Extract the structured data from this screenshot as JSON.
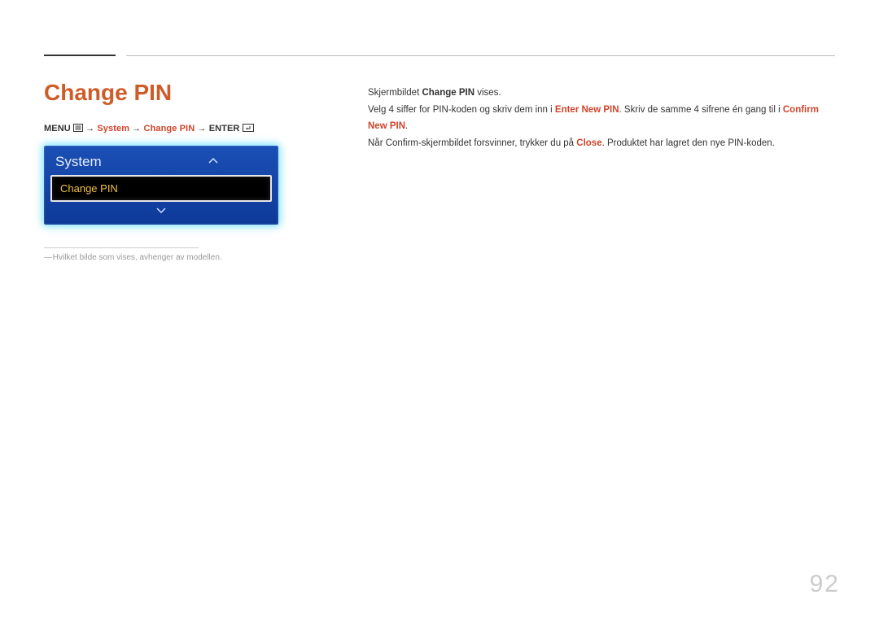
{
  "page": {
    "title": "Change PIN",
    "number": "92"
  },
  "breadcrumb": {
    "menu": "MENU",
    "arrow": " → ",
    "part1": "System",
    "part2": "Change PIN",
    "enter": "ENTER"
  },
  "tv_menu": {
    "header": "System",
    "selected": "Change PIN"
  },
  "footnote": "Hvilket bilde som vises, avhenger av modellen.",
  "body": {
    "line1_pre": "Skjermbildet ",
    "line1_bold": "Change PIN",
    "line1_post": " vises.",
    "line2_pre": "Velg 4 siffer for PIN-koden og skriv dem inn i ",
    "line2_red1": "Enter New PIN",
    "line2_mid": ". Skriv de samme 4 sifrene én gang til i ",
    "line2_red2": "Confirm New PIN",
    "line2_post": ".",
    "line3_pre": "Når Confirm-skjermbildet forsvinner, trykker du på ",
    "line3_red": "Close",
    "line3_post": ". Produktet har lagret den nye PIN-koden."
  }
}
